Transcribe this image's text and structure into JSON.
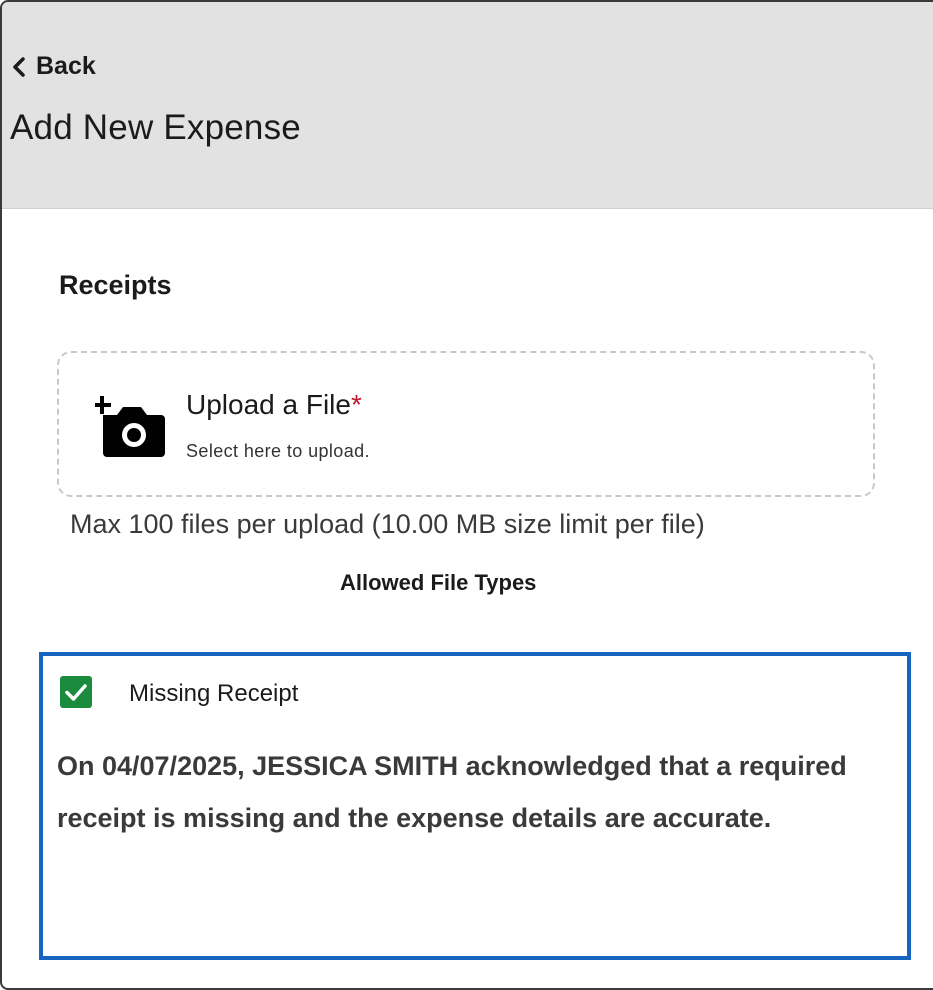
{
  "header": {
    "back_label": "Back",
    "title": "Add New Expense"
  },
  "receipts": {
    "section_title": "Receipts",
    "upload": {
      "title": "Upload a File",
      "required_marker": "*",
      "subtitle": "Select here to upload.",
      "icon": "add-camera-icon"
    },
    "limit_text": "Max 100 files per upload (10.00 MB size limit per file)",
    "allowed_types_label": "Allowed File Types"
  },
  "missing_receipt": {
    "checked": true,
    "label": "Missing Receipt",
    "acknowledgement": "On 04/07/2025, JESSICA SMITH acknowledged that a required receipt is missing and the expense details are accurate."
  },
  "colors": {
    "header_bg": "#e2e2e2",
    "accent_border": "#1565c0",
    "checkbox_green": "#1a8a3c",
    "required_red": "#c0152a"
  }
}
